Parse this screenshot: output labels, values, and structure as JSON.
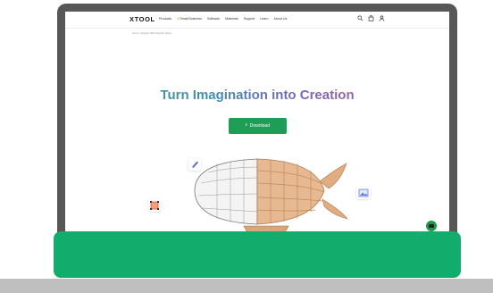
{
  "brand": {
    "logo_text": "XTOOL"
  },
  "nav": {
    "items": [
      "Products",
      "Small Business",
      "Software",
      "Materials",
      "Support",
      "Learn",
      "About Us"
    ]
  },
  "nav_icons": [
    "search-icon",
    "bag-icon",
    "user-icon"
  ],
  "breadcrumb": "Home / Software /Bird Zeppelin Space",
  "hero": {
    "title": "Turn Imagination into Creation"
  },
  "download": {
    "label": "Download",
    "icon": "download-icon"
  },
  "colors": {
    "accent_green": "#1f9d57",
    "banner_green": "#12ad6d",
    "frame": "#575757"
  }
}
